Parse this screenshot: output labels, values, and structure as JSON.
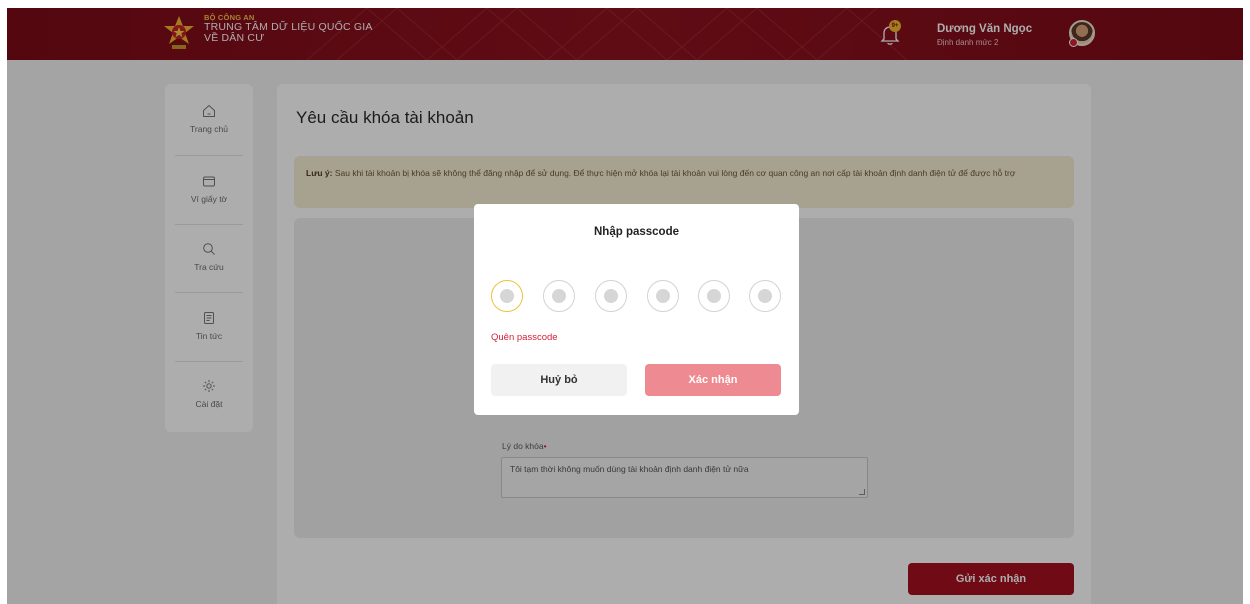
{
  "header": {
    "org_line1": "BỘ CÔNG AN",
    "org_line2": "TRUNG TÂM DỮ LIỆU QUỐC GIA",
    "org_line3": "VỀ DÂN CƯ",
    "notification_badge": "9+",
    "user_name": "Dương Văn Ngọc",
    "user_level": "Định danh mức 2"
  },
  "sidebar": {
    "items": [
      {
        "label": "Trang chủ",
        "icon": "home-icon"
      },
      {
        "label": "Ví giấy tờ",
        "icon": "wallet-icon"
      },
      {
        "label": "Tra cứu",
        "icon": "search-icon"
      },
      {
        "label": "Tin tức",
        "icon": "news-icon"
      },
      {
        "label": "Cài đặt",
        "icon": "gear-icon"
      }
    ]
  },
  "main": {
    "title": "Yêu cầu khóa tài khoản",
    "notice_label": "Lưu ý:",
    "notice_text": "Sau khi tài khoản bị khóa sẽ không thể đăng nhập để sử dụng. Để thực hiện mở khóa lại tài khoản vui lòng đến cơ quan công an nơi cấp tài khoản định danh điện tử để được hỗ trợ",
    "reason_label": "Lý do khóa",
    "reason_value": "Tôi tạm thời không muốn dùng tài khoản định danh điện tử nữa",
    "submit_label": "Gửi xác nhận"
  },
  "modal": {
    "title": "Nhập passcode",
    "digits_count": 6,
    "forgot_label": "Quên passcode",
    "cancel_label": "Huỷ bỏ",
    "confirm_label": "Xác nhận"
  },
  "colors": {
    "header_bg": "#8e1220",
    "accent_red": "#a5101f",
    "confirm_disabled": "#ee8b92",
    "notice_bg": "#f7edd5",
    "active_dot_border": "#e9c43b"
  }
}
